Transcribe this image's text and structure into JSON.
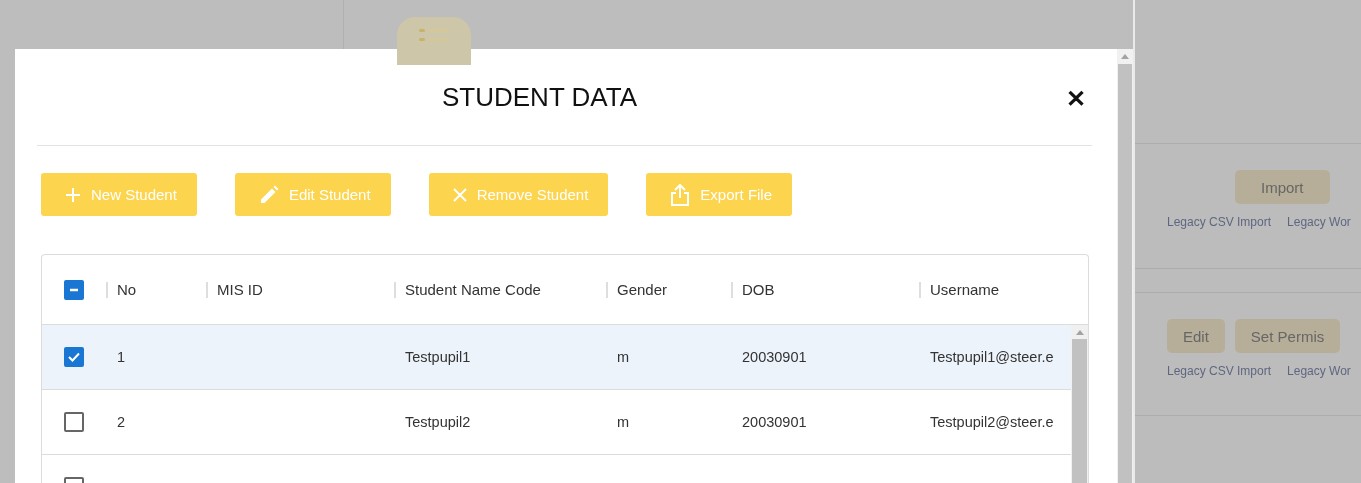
{
  "modal": {
    "title": "STUDENT DATA",
    "close": "✕",
    "actions": [
      {
        "kind": "add",
        "label": "New Student"
      },
      {
        "kind": "edit",
        "label": "Edit Student"
      },
      {
        "kind": "remove",
        "label": "Remove Student"
      },
      {
        "kind": "export",
        "label": "Export File"
      }
    ],
    "table": {
      "select_all": {
        "indeterminate": true
      },
      "columns": [
        "No",
        "MIS ID",
        "Student Name Code",
        "Gender",
        "DOB",
        "Username"
      ],
      "rows": [
        {
          "checked": true,
          "selected": true,
          "cells": [
            "1",
            "",
            "Testpupil1",
            "m",
            "20030901",
            "Testpupil1@steer.e"
          ]
        },
        {
          "checked": false,
          "selected": false,
          "cells": [
            "2",
            "",
            "Testpupil2",
            "m",
            "20030901",
            "Testpupil2@steer.e"
          ]
        },
        {
          "checked": false,
          "selected": false,
          "cells": []
        }
      ]
    }
  },
  "background": {
    "sections": [
      {
        "buttons": [
          "Import"
        ],
        "links": [
          "Legacy CSV Import",
          "Legacy Wor"
        ]
      },
      {
        "buttons": [
          "Edit",
          "Set Permis"
        ],
        "links": [
          "Legacy CSV Import",
          "Legacy Wor"
        ]
      }
    ]
  }
}
